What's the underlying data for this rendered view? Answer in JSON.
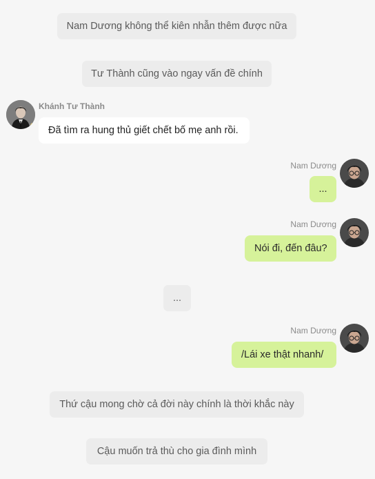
{
  "characters": {
    "left": {
      "name": "Khánh Tư Thành",
      "avatar_icon": "male-avatar-suit-icon"
    },
    "right": {
      "name": "Nam Dương",
      "avatar_icon": "male-avatar-glasses-icon"
    }
  },
  "colors": {
    "background": "#f6f6f6",
    "narration_bg": "#ececec",
    "incoming_bubble": "#ffffff",
    "outgoing_bubble": "#d6f29a"
  },
  "messages": [
    {
      "type": "narration",
      "text": "Nam Dương không thể kiên nhẫn thêm được nữa"
    },
    {
      "type": "narration",
      "text": "Tư Thành cũng vào ngay vấn đề chính"
    },
    {
      "type": "incoming",
      "sender": "Khánh Tư Thành",
      "text": "Đã tìm ra hung thủ giết chết bố mẹ anh rồi."
    },
    {
      "type": "outgoing",
      "sender": "Nam Dương",
      "text": "..."
    },
    {
      "type": "outgoing",
      "sender": "Nam Dương",
      "text": "Nói đi, đến đâu?"
    },
    {
      "type": "narration",
      "text": "..."
    },
    {
      "type": "outgoing",
      "sender": "Nam Dương",
      "text": "/Lái xe thật nhanh/"
    },
    {
      "type": "narration",
      "text": "Thứ cậu mong chờ cả đời này chính là thời khắc này"
    },
    {
      "type": "narration",
      "text": "Cậu muốn trả thù cho gia đình mình"
    }
  ]
}
